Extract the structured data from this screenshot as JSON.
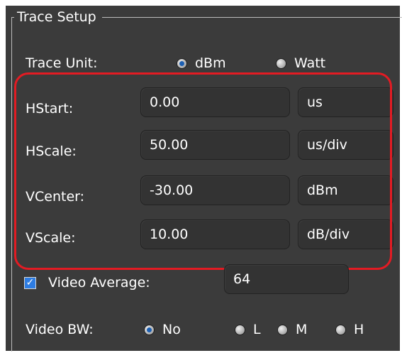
{
  "trace_setup": {
    "title": "Trace Setup",
    "trace_unit": {
      "label": "Trace Unit:",
      "options": [
        "dBm",
        "Watt"
      ],
      "selected": "dBm"
    },
    "fields": [
      {
        "label": "HStart:",
        "value": "0.00",
        "unit": "us"
      },
      {
        "label": "HScale:",
        "value": "50.00",
        "unit": "us/div"
      },
      {
        "label": "VCenter:",
        "value": "-30.00",
        "unit": "dBm"
      },
      {
        "label": "VScale:",
        "value": "10.00",
        "unit": "dB/div"
      }
    ],
    "video_average": {
      "label": "Video Average:",
      "checked": true,
      "value": "64"
    },
    "video_bw": {
      "label": "Video BW:",
      "options": [
        "No",
        "L",
        "M",
        "H"
      ],
      "selected": "No"
    }
  },
  "colors": {
    "panel_background": "#3b3b3b",
    "field_background": "#333333",
    "highlight_border": "#e31b23",
    "selected_radio": "#1c5fb2"
  },
  "icons": {
    "checkbox": "checkmark-icon",
    "radio_selected": "radio-selected-icon",
    "radio_unselected": "radio-unselected-icon"
  }
}
